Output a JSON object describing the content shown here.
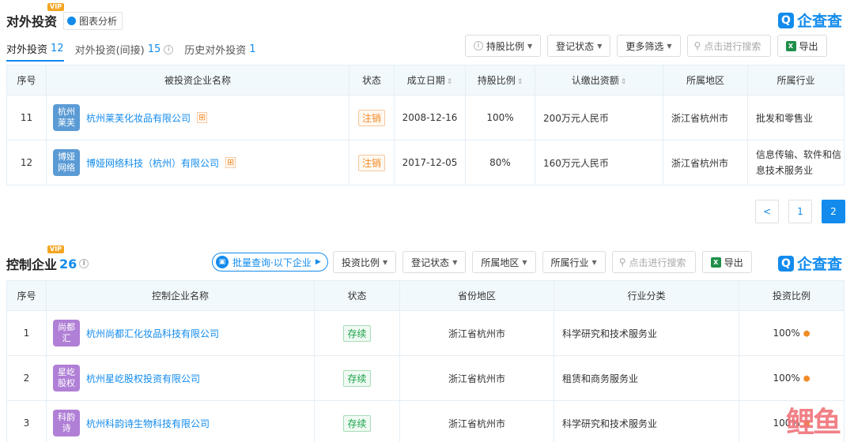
{
  "section1": {
    "title": "对外投资",
    "vip": "VIP",
    "chart_btn": "图表分析",
    "logo": "企查查",
    "tabs": [
      {
        "label": "对外投资",
        "count": "12"
      },
      {
        "label": "对外投资(间接)",
        "count": "15"
      },
      {
        "label": "历史对外投资",
        "count": "1"
      }
    ],
    "filters": [
      "持股比例",
      "登记状态",
      "更多筛选"
    ],
    "search_placeholder": "点击进行搜索",
    "export": "导出",
    "columns": [
      "序号",
      "被投资企业名称",
      "状态",
      "成立日期",
      "持股比例",
      "认缴出资额",
      "所属地区",
      "所属行业"
    ],
    "rows": [
      {
        "no": "11",
        "avatar": "杭州莱芙",
        "avatar_color": "#5b9bd5",
        "name": "杭州莱芙化妆品有限公司",
        "status": "注销",
        "date": "2008-12-16",
        "ratio": "100%",
        "capital": "200万元人民币",
        "region": "浙江省杭州市",
        "industry": "批发和零售业"
      },
      {
        "no": "12",
        "avatar": "博娅网络",
        "avatar_color": "#5b9bd5",
        "name": "博娅网络科技（杭州）有限公司",
        "status": "注销",
        "date": "2017-12-05",
        "ratio": "80%",
        "capital": "160万元人民币",
        "region": "浙江省杭州市",
        "industry": "信息传输、软件和信息技术服务业"
      }
    ],
    "pager": {
      "prev": "<",
      "pages": [
        "1",
        "2"
      ],
      "current": "2"
    }
  },
  "section2": {
    "title": "控制企业",
    "count": "26",
    "vip": "VIP",
    "batch_btn": "批量查询·以下企业",
    "filters": [
      "投资比例",
      "登记状态",
      "所属地区",
      "所属行业"
    ],
    "search_placeholder": "点击进行搜索",
    "export": "导出",
    "logo": "企查查",
    "columns": [
      "序号",
      "控制企业名称",
      "状态",
      "省份地区",
      "行业分类",
      "投资比例"
    ],
    "rows": [
      {
        "no": "1",
        "avatar": "尚都汇",
        "avatar_color": "#b07fd6",
        "name": "杭州尚都汇化妆品科技有限公司",
        "status": "存续",
        "region": "浙江省杭州市",
        "industry": "科学研究和技术服务业",
        "ratio": "100%"
      },
      {
        "no": "2",
        "avatar": "星屹股权",
        "avatar_color": "#b07fd6",
        "name": "杭州星屹股权投资有限公司",
        "status": "存续",
        "region": "浙江省杭州市",
        "industry": "租赁和商务服务业",
        "ratio": "100%"
      },
      {
        "no": "3",
        "avatar": "科韵诗",
        "avatar_color": "#b07fd6",
        "name": "杭州科韵诗生物科技有限公司",
        "status": "存续",
        "region": "浙江省杭州市",
        "industry": "科学研究和技术服务业",
        "ratio": "100%"
      }
    ]
  },
  "watermark": "鲤鱼"
}
